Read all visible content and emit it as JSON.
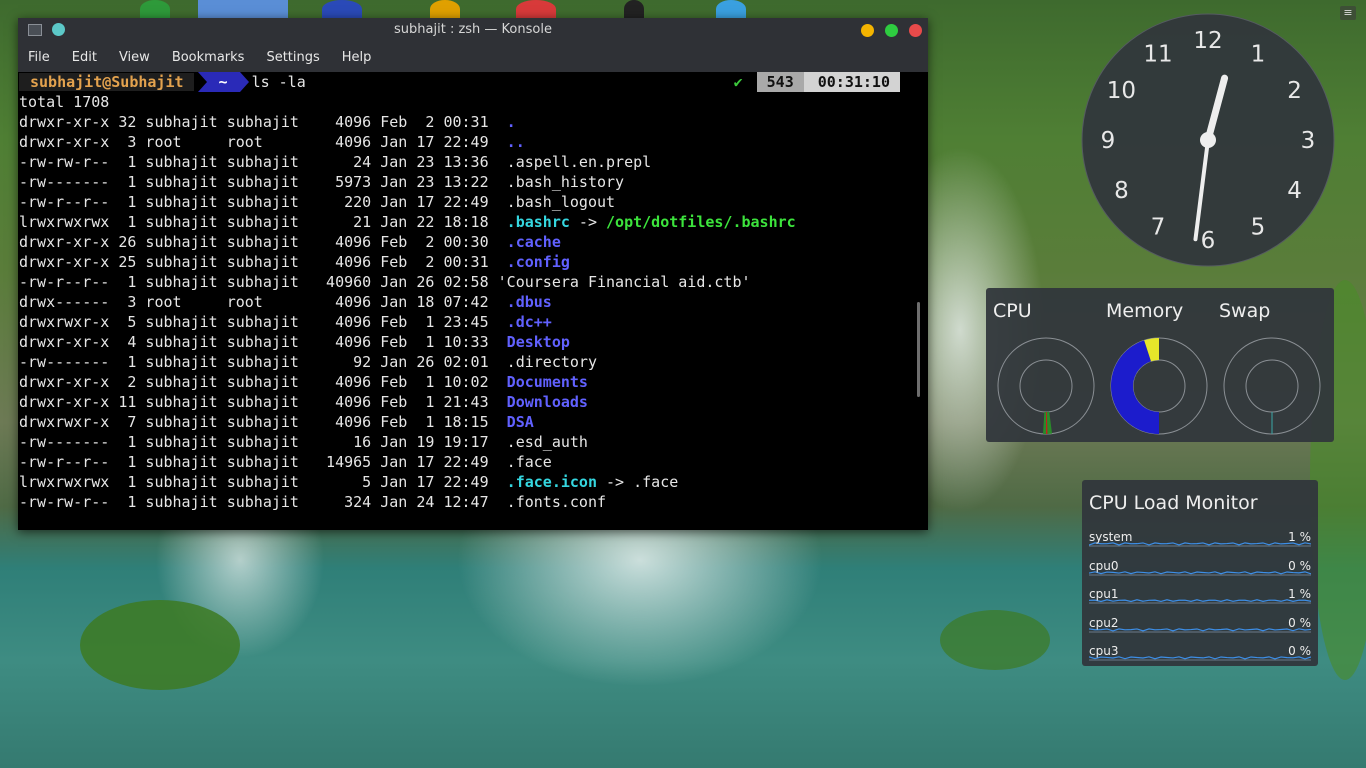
{
  "window": {
    "title": "subhajit : zsh — Konsole",
    "menu": [
      "File",
      "Edit",
      "View",
      "Bookmarks",
      "Settings",
      "Help"
    ]
  },
  "terminal": {
    "prompt_user": "subhajit@Subhajit",
    "prompt_dir": "~",
    "command": "ls -la",
    "status_check": "✔",
    "history_number": "543",
    "time": "00:31:10",
    "total": "total 1708",
    "entries": [
      {
        "meta": "drwxr-xr-x 32 subhajit subhajit    4096 Feb  2 00:31  ",
        "name": ".",
        "style": "dir",
        "target": ""
      },
      {
        "meta": "drwxr-xr-x  3 root     root        4096 Jan 17 22:49  ",
        "name": "..",
        "style": "dir",
        "target": ""
      },
      {
        "meta": "-rw-rw-r--  1 subhajit subhajit      24 Jan 23 13:36  ",
        "name": ".aspell.en.prepl",
        "style": "file",
        "target": ""
      },
      {
        "meta": "-rw-------  1 subhajit subhajit    5973 Jan 23 13:22  ",
        "name": ".bash_history",
        "style": "file",
        "target": ""
      },
      {
        "meta": "-rw-r--r--  1 subhajit subhajit     220 Jan 17 22:49  ",
        "name": ".bash_logout",
        "style": "file",
        "target": ""
      },
      {
        "meta": "lrwxrwxrwx  1 subhajit subhajit      21 Jan 22 18:18  ",
        "name": ".bashrc",
        "style": "link",
        "target": "/opt/dotfiles/.bashrc"
      },
      {
        "meta": "drwxr-xr-x 26 subhajit subhajit    4096 Feb  2 00:30  ",
        "name": ".cache",
        "style": "dir",
        "target": ""
      },
      {
        "meta": "drwxr-xr-x 25 subhajit subhajit    4096 Feb  2 00:31  ",
        "name": ".config",
        "style": "dir",
        "target": ""
      },
      {
        "meta": "-rw-r--r--  1 subhajit subhajit   40960 Jan 26 02:58 ",
        "name": "'Coursera Financial aid.ctb'",
        "style": "file",
        "target": ""
      },
      {
        "meta": "drwx------  3 root     root        4096 Jan 18 07:42  ",
        "name": ".dbus",
        "style": "dir",
        "target": ""
      },
      {
        "meta": "drwxrwxr-x  5 subhajit subhajit    4096 Feb  1 23:45  ",
        "name": ".dc++",
        "style": "dir",
        "target": ""
      },
      {
        "meta": "drwxr-xr-x  4 subhajit subhajit    4096 Feb  1 10:33  ",
        "name": "Desktop",
        "style": "dir",
        "target": ""
      },
      {
        "meta": "-rw-------  1 subhajit subhajit      92 Jan 26 02:01  ",
        "name": ".directory",
        "style": "file",
        "target": ""
      },
      {
        "meta": "drwxr-xr-x  2 subhajit subhajit    4096 Feb  1 10:02  ",
        "name": "Documents",
        "style": "dir",
        "target": ""
      },
      {
        "meta": "drwxr-xr-x 11 subhajit subhajit    4096 Feb  1 21:43  ",
        "name": "Downloads",
        "style": "dir",
        "target": ""
      },
      {
        "meta": "drwxrwxr-x  7 subhajit subhajit    4096 Feb  1 18:15  ",
        "name": "DSA",
        "style": "dir",
        "target": ""
      },
      {
        "meta": "-rw-------  1 subhajit subhajit      16 Jan 19 19:17  ",
        "name": ".esd_auth",
        "style": "file",
        "target": ""
      },
      {
        "meta": "-rw-r--r--  1 subhajit subhajit   14965 Jan 17 22:49  ",
        "name": ".face",
        "style": "file",
        "target": ""
      },
      {
        "meta": "lrwxrwxrwx  1 subhajit subhajit       5 Jan 17 22:49  ",
        "name": ".face.icon",
        "style": "link",
        "target": ".face"
      },
      {
        "meta": "-rw-rw-r--  1 subhajit subhajit     324 Jan 24 12:47  ",
        "name": ".fonts.conf",
        "style": "file",
        "target": ""
      }
    ]
  },
  "clock": {
    "numbers": [
      "12",
      "1",
      "2",
      "3",
      "4",
      "5",
      "6",
      "7",
      "8",
      "9",
      "10",
      "11"
    ],
    "hour": 0.5,
    "minute": 31.2
  },
  "system_monitor": {
    "labels": [
      "CPU",
      "Memory",
      "Swap"
    ],
    "cpu_fraction": 0.05,
    "memory_used_fraction": 0.45,
    "memory_cache_fraction": 0.05,
    "swap_fraction": 0.0,
    "colors": {
      "cpu_user": "#2a8a2a",
      "cpu_sys": "#c02020",
      "mem_used": "#1c1ccc",
      "mem_cache": "#e6e62a",
      "swap": "#3aa8a8"
    }
  },
  "cpu_load_monitor": {
    "title": "CPU Load Monitor",
    "rows": [
      {
        "name": "system",
        "value": "1 %"
      },
      {
        "name": "cpu0",
        "value": "0 %"
      },
      {
        "name": "cpu1",
        "value": "1 %"
      },
      {
        "name": "cpu2",
        "value": "0 %"
      },
      {
        "name": "cpu3",
        "value": "0 %"
      }
    ]
  }
}
